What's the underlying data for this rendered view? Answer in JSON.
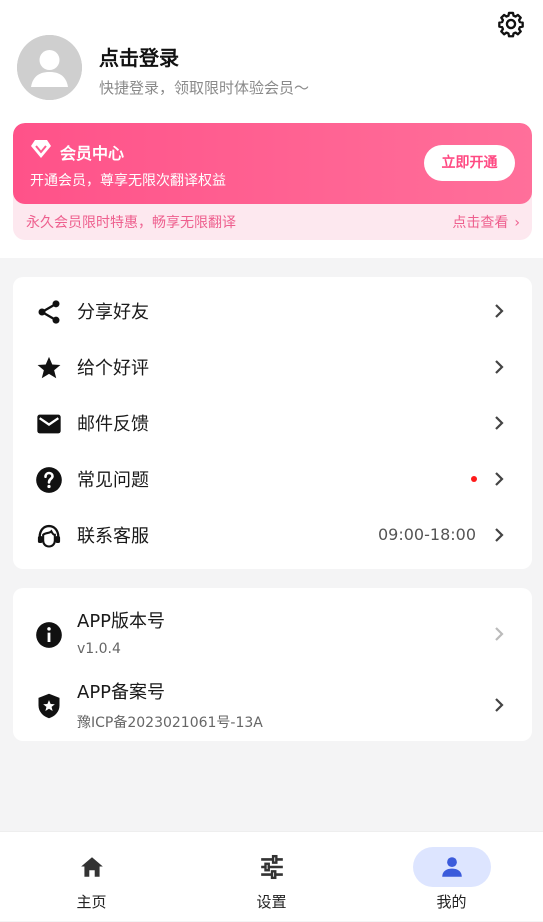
{
  "header": {
    "login_title": "点击登录",
    "login_subtitle": "快捷登录，领取限时体验会员～"
  },
  "vip": {
    "title": "会员中心",
    "description": "开通会员，尊享无限次翻译权益",
    "button": "立即开通",
    "promo": "永久会员限时特惠，畅享无限翻译",
    "more": "点击查看"
  },
  "menu": [
    {
      "label": "分享好友",
      "icon": "share-icon"
    },
    {
      "label": "给个好评",
      "icon": "star-icon"
    },
    {
      "label": "邮件反馈",
      "icon": "mail-icon"
    },
    {
      "label": "常见问题",
      "icon": "help-icon",
      "badge": "red-dot"
    },
    {
      "label": "联系客服",
      "icon": "headset-icon",
      "right_text": "09:00-18:00"
    }
  ],
  "info": [
    {
      "label": "APP版本号",
      "sub": "v1.0.4",
      "icon": "info-icon"
    },
    {
      "label": "APP备案号",
      "sub": "豫ICP备2023021061号-13A",
      "icon": "shield-star-icon"
    }
  ],
  "nav": [
    {
      "label": "主页",
      "icon": "home-icon"
    },
    {
      "label": "设置",
      "icon": "sliders-icon"
    },
    {
      "label": "我的",
      "icon": "person-icon",
      "active": true
    }
  ],
  "colors": {
    "vip_gradient_start": "#ff5289",
    "vip_gradient_end": "#ff6f9a",
    "vip_accent": "#ee5f8e",
    "nav_active_pill": "#dde5ff",
    "nav_active_icon": "#3b5bdb",
    "badge_red": "#ff1a1a"
  }
}
